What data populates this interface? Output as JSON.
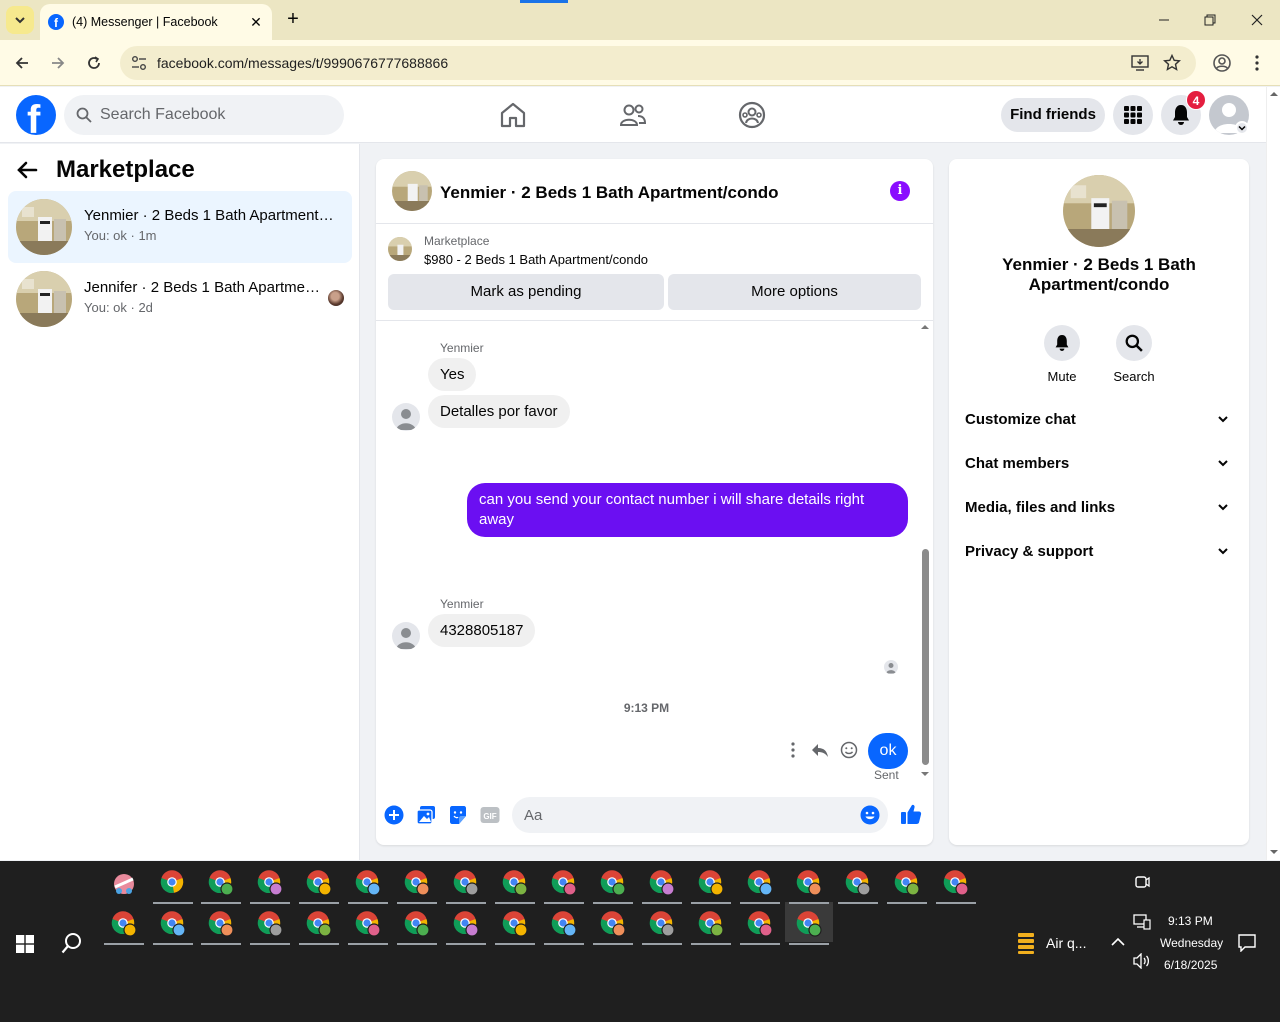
{
  "browser": {
    "tab_title": "(4) Messenger | Facebook",
    "url": "facebook.com/messages/t/9990676777688866"
  },
  "fb_header": {
    "search_placeholder": "Search Facebook",
    "find_friends": "Find friends",
    "notification_count": "4"
  },
  "left": {
    "title": "Marketplace",
    "conversations": [
      {
        "name": "Yenmier · 2 Beds 1 Bath Apartment/condo",
        "preview": "You: ok · 1m",
        "active": true
      },
      {
        "name": "Jennifer · 2 Beds 1 Bath Apartment/condo",
        "preview": "You: ok · 2d",
        "active": false
      }
    ]
  },
  "chat": {
    "title": "Yenmier · 2 Beds 1 Bath Apartment/condo",
    "marketplace_label": "Marketplace",
    "listing": "$980 - 2 Beds 1 Bath Apartment/condo",
    "buttons": {
      "pending": "Mark as pending",
      "more": "More options"
    },
    "messages": [
      {
        "sender": "Yenmier",
        "text": "Yes"
      },
      {
        "text": "Detalles por favor"
      },
      {
        "outgoing": true,
        "text": "can you send your contact number i will share details right away"
      },
      {
        "sender": "Yenmier",
        "text": "4328805187"
      }
    ],
    "timestamp": "9:13 PM",
    "last_sent": {
      "text": "ok",
      "status": "Sent"
    },
    "composer_placeholder": "Aa"
  },
  "info": {
    "name": "Yenmier · 2 Beds 1 Bath Apartment/condo",
    "actions": {
      "mute": "Mute",
      "search": "Search"
    },
    "sections": [
      "Customize chat",
      "Chat members",
      "Media, files and links",
      "Privacy & support"
    ]
  },
  "taskbar": {
    "weather": "Air q...",
    "time": "9:13 PM",
    "day": "Wednesday",
    "date": "6/18/2025"
  },
  "colors": {
    "fb_blue": "#0866ff",
    "outgoing_bubble": "#6b0ff2",
    "badge": "#e41e3f"
  }
}
